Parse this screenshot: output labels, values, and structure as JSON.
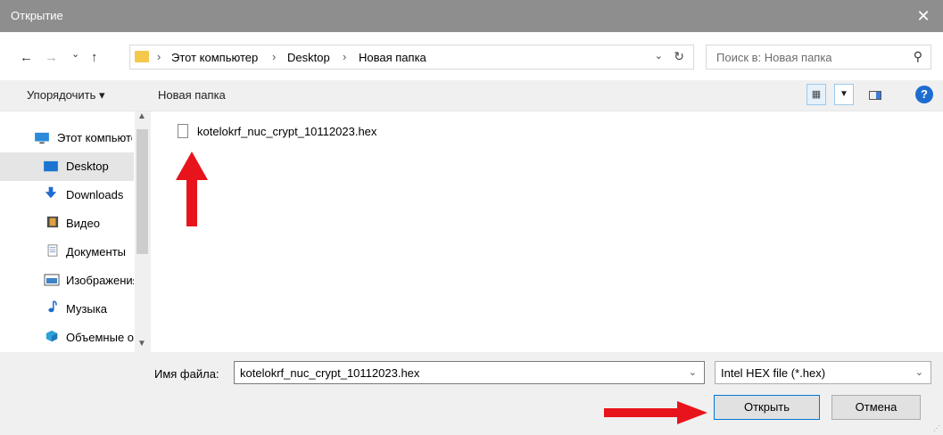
{
  "window": {
    "title": "Открытие",
    "close_glyph": "✕"
  },
  "nav": {
    "back_glyph": "←",
    "forward_glyph": "→",
    "history_glyph": "⌄",
    "up_glyph": "↑",
    "breadcrumb_sep": "›",
    "breadcrumb": [
      "Этот компьютер",
      "Desktop",
      "Новая папка"
    ],
    "address_dropdown_glyph": "⌄",
    "refresh_glyph": "↻",
    "search_placeholder": "Поиск в: Новая папка",
    "search_icon_glyph": "⚲"
  },
  "toolbar": {
    "organize_label": "Упорядочить ▾",
    "new_folder_label": "Новая папка",
    "view_glyph": "▦",
    "view_dropdown_glyph": "▼",
    "help_glyph": "?"
  },
  "sidebar": {
    "scroll_up_glyph": "▲",
    "scroll_down_glyph": "▼",
    "items": [
      {
        "label": "Этот компьютер",
        "icon": "computer-icon"
      },
      {
        "label": "Desktop",
        "icon": "desktop-icon",
        "selected": true
      },
      {
        "label": "Downloads",
        "icon": "download-icon"
      },
      {
        "label": "Видео",
        "icon": "video-icon"
      },
      {
        "label": "Документы",
        "icon": "documents-icon"
      },
      {
        "label": "Изображения",
        "icon": "pictures-icon"
      },
      {
        "label": "Музыка",
        "icon": "music-icon"
      },
      {
        "label": "Объемные объекты",
        "icon": "3d-objects-icon"
      }
    ]
  },
  "files": [
    {
      "name": "kotelokrf_nuc_crypt_10112023.hex"
    }
  ],
  "bottom": {
    "filename_label": "Имя файла:",
    "filename_value": "kotelokrf_nuc_crypt_10112023.hex",
    "dropdown_glyph": "⌄",
    "filetype_value": "Intel HEX file (*.hex)",
    "open_label": "Открыть",
    "cancel_label": "Отмена"
  },
  "colors": {
    "annotation_arrow": "#e8141b",
    "titlebar": "#8e8e8e",
    "accent": "#0078d7"
  }
}
